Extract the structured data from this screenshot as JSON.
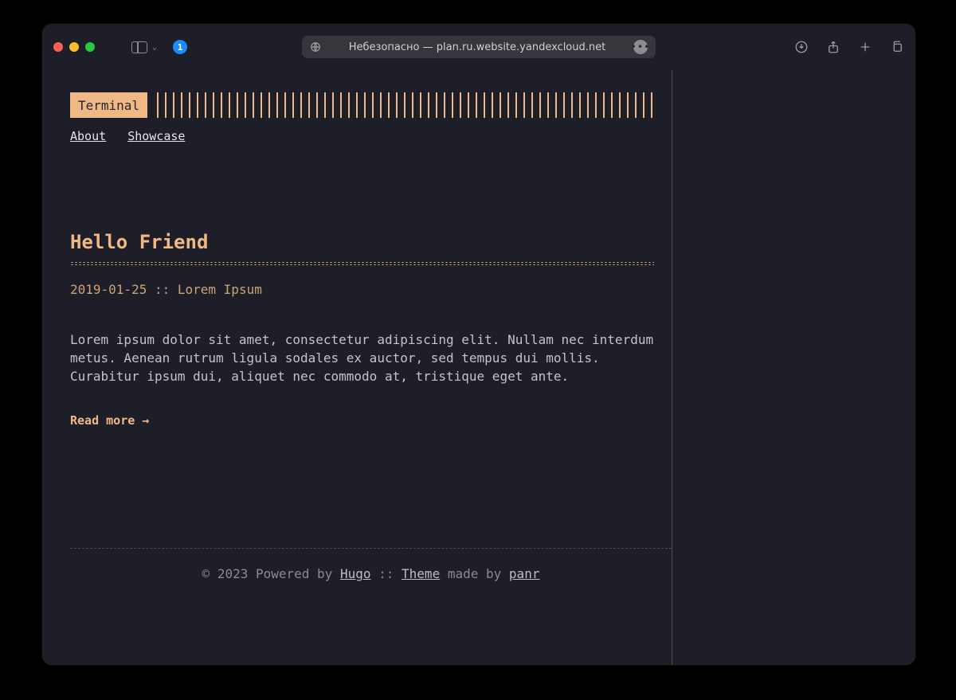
{
  "browser": {
    "address": "Небезопасно — plan.ru.website.yandexcloud.net",
    "ext_badge": "1"
  },
  "header": {
    "logo": "Terminal",
    "nav": [
      {
        "label": "About"
      },
      {
        "label": "Showcase"
      }
    ]
  },
  "post": {
    "title": "Hello Friend",
    "date": "2019-01-25",
    "sep": "::",
    "author": "Lorem Ipsum",
    "excerpt": "Lorem ipsum dolor sit amet, consectetur adipiscing elit. Nullam nec interdum metus. Aenean rutrum ligula sodales ex auctor, sed tempus dui mollis. Curabitur ipsum dui, aliquet nec commodo at, tristique eget ante.",
    "read_more": "Read more →"
  },
  "footer": {
    "copyright": "© 2023",
    "powered_by": "Powered by",
    "hugo": "Hugo",
    "sep": "::",
    "theme": "Theme",
    "made_by": "made by",
    "author": "panr"
  }
}
